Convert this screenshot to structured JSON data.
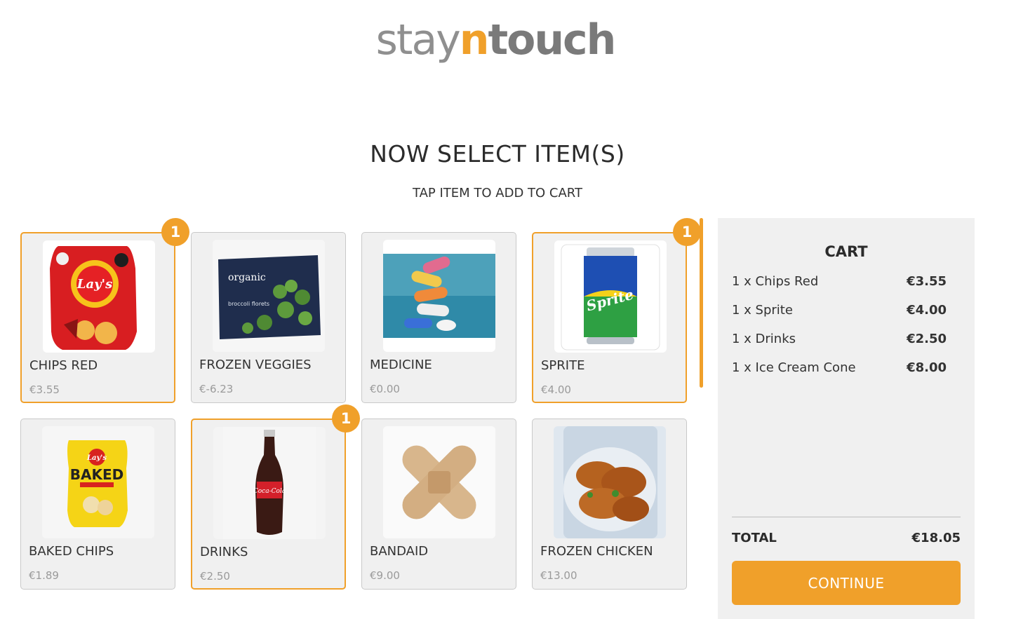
{
  "logo": {
    "part1": "stay",
    "part2": "n",
    "part3": "touch"
  },
  "heading": "NOW SELECT ITEM(S)",
  "subheading": "TAP ITEM TO ADD TO CART",
  "colors": {
    "accent": "#f0a02a",
    "card_bg": "#f0f0f0",
    "cart_bg": "#f0f0f0"
  },
  "items": [
    {
      "name": "CHIPS RED",
      "price": "€3.55",
      "selected": true,
      "badge": "1",
      "icon": "chips-red-bag-icon"
    },
    {
      "name": "FROZEN VEGGIES",
      "price": "€-6.23",
      "selected": false,
      "badge": "",
      "icon": "frozen-broccoli-bag-icon"
    },
    {
      "name": "MEDICINE",
      "price": "€0.00",
      "selected": false,
      "badge": "",
      "icon": "pills-icon"
    },
    {
      "name": "SPRITE",
      "price": "€4.00",
      "selected": true,
      "badge": "1",
      "icon": "soda-can-icon"
    },
    {
      "name": "BAKED CHIPS",
      "price": "€1.89",
      "selected": false,
      "badge": "",
      "icon": "baked-chips-bag-icon"
    },
    {
      "name": "DRINKS",
      "price": "€2.50",
      "selected": true,
      "badge": "1",
      "icon": "cola-bottle-icon"
    },
    {
      "name": "BANDAID",
      "price": "€9.00",
      "selected": false,
      "badge": "",
      "icon": "bandaid-icon"
    },
    {
      "name": "FROZEN CHICKEN",
      "price": "€13.00",
      "selected": false,
      "badge": "",
      "icon": "fried-chicken-icon"
    }
  ],
  "cart": {
    "title": "CART",
    "lines": [
      {
        "label": "1 x Chips Red",
        "amount": "€3.55"
      },
      {
        "label": "1 x Sprite",
        "amount": "€4.00"
      },
      {
        "label": "1 x Drinks",
        "amount": "€2.50"
      },
      {
        "label": "1 x Ice Cream Cone",
        "amount": "€8.00"
      }
    ],
    "total_label": "TOTAL",
    "total_value": "€18.05",
    "continue_label": "CONTINUE"
  }
}
